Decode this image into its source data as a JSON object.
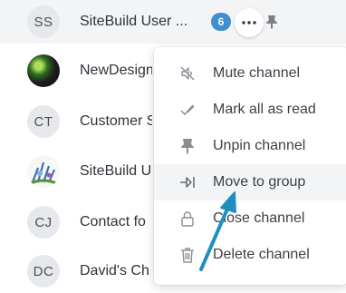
{
  "channels": [
    {
      "initials": "SS",
      "name": "SiteBuild User ...",
      "unread": "6"
    },
    {
      "initials": "",
      "name": "NewDesign"
    },
    {
      "initials": "CT",
      "name": "Customer S"
    },
    {
      "initials": "",
      "name": "SiteBuild U"
    },
    {
      "initials": "CJ",
      "name": "Contact fo"
    },
    {
      "initials": "DC",
      "name": "David's Ch"
    }
  ],
  "menu": {
    "items": [
      {
        "label": "Mute channel",
        "icon": "mute-icon"
      },
      {
        "label": "Mark all as read",
        "icon": "check-icon"
      },
      {
        "label": "Unpin channel",
        "icon": "pin-icon"
      },
      {
        "label": "Move to group",
        "icon": "move-icon"
      },
      {
        "label": "Close channel",
        "icon": "lock-icon"
      },
      {
        "label": "Delete channel",
        "icon": "trash-icon"
      }
    ]
  },
  "colors": {
    "badge": "#3e8ed0",
    "arrow": "#1f8fbf",
    "hover": "#f3f4f6"
  }
}
